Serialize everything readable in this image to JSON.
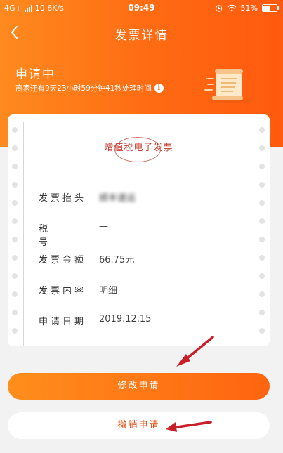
{
  "status_bar": {
    "network": "4G+",
    "speed": "10.6K/s",
    "time": "09:49",
    "battery": "51%"
  },
  "nav": {
    "title": "发票详情",
    "back_icon": "chevron-left-icon"
  },
  "status": {
    "title": "申请中",
    "description": "商家还有9天23小时59分钟41秒处理时间",
    "info_icon": "info-icon"
  },
  "invoice": {
    "type_label": "增值税电子发票",
    "fields": [
      {
        "label": "发票抬头",
        "value": "顺丰速运"
      },
      {
        "label": "税号",
        "value": "—"
      },
      {
        "label": "发票金额",
        "value": "66.75元"
      },
      {
        "label": "发票内容",
        "value": "明细"
      },
      {
        "label": "申请日期",
        "value": "2019.12.15"
      }
    ]
  },
  "actions": {
    "modify_label": "修改申请",
    "cancel_label": "撤销申请"
  },
  "colors": {
    "accent": "#ff6a12",
    "stamp": "#c43b2d",
    "annotation_arrow": "#c8202a"
  }
}
